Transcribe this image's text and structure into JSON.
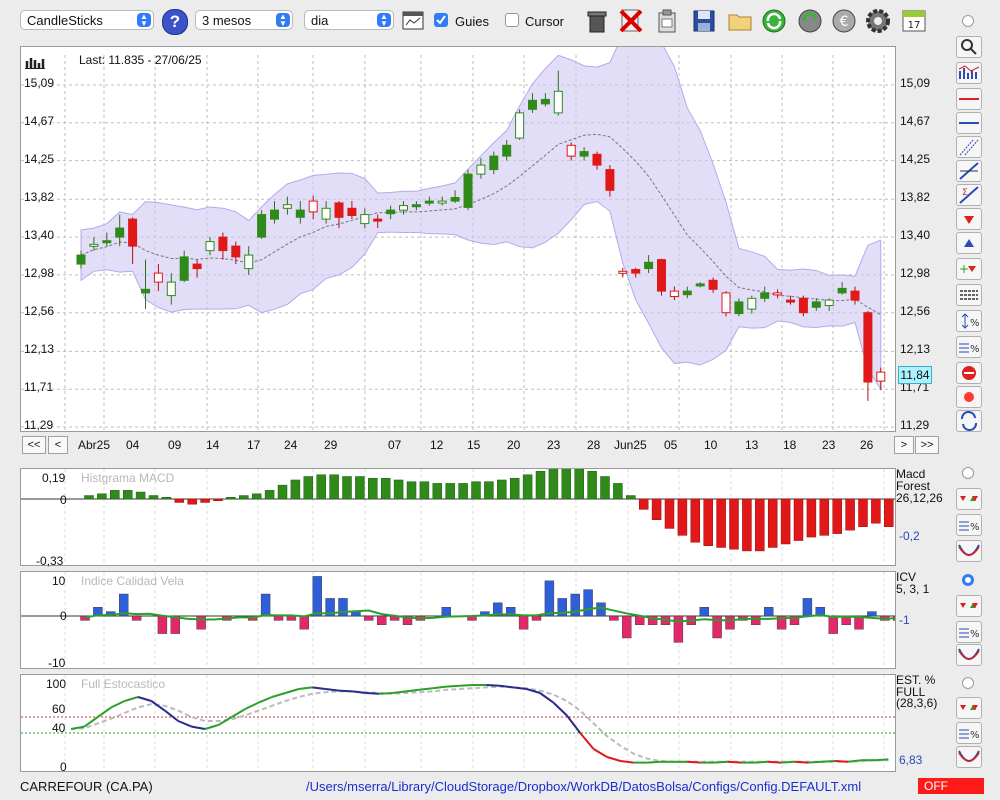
{
  "toolbar": {
    "chart_type": "CandleSticks",
    "period": "3 mesos",
    "interval": "dia",
    "guies_label": "Guies",
    "guies_checked": true,
    "cursor_label": "Cursor",
    "cursor_checked": false,
    "calendar_day": "17",
    "icons": [
      "help-icon",
      "trash-icon",
      "delete-icon",
      "clipboard-icon",
      "save-icon",
      "folder-icon",
      "refresh-icon",
      "refresh-alt-icon",
      "currency-icon",
      "gear-icon",
      "calendar-icon"
    ]
  },
  "price_chart": {
    "last_label": "Last: 11.835 - 27/06/25",
    "current_value": "11,84",
    "left_ticks": [
      "15,09",
      "14,67",
      "14,25",
      "13,82",
      "13,40",
      "12,98",
      "12,56",
      "12,13",
      "11,71",
      "11,29"
    ],
    "right_ticks": [
      "15,09",
      "14,67",
      "14,25",
      "13,82",
      "13,40",
      "12,98",
      "12,56",
      "12,13",
      "11,71",
      "11,29"
    ],
    "x_labels": [
      "Abr25",
      "04",
      "09",
      "14",
      "17",
      "24",
      "29",
      "07",
      "12",
      "15",
      "20",
      "23",
      "28",
      "Jun25",
      "05",
      "10",
      "13",
      "18",
      "23",
      "26"
    ],
    "nav": [
      "<<",
      "<",
      ">",
      ">>"
    ]
  },
  "macd": {
    "name": "Histgrama MACD",
    "ticks": [
      "0,19",
      "0",
      "-0,33"
    ],
    "legend1": "Macd",
    "legend2": "Forest",
    "params": "26,12,26",
    "value": "-0,2"
  },
  "icv": {
    "name": "Indice Calidad Vela",
    "ticks": [
      "10",
      "0",
      "-10"
    ],
    "legend1": "ICV",
    "params": "5, 3, 1",
    "value": "-1"
  },
  "stoch": {
    "name": "Full Estocastico",
    "ticks": [
      "100",
      "60",
      "40",
      "0"
    ],
    "legend1": "EST. %",
    "legend2": "FULL",
    "params": "(28,3,6)",
    "value": "6,83"
  },
  "status": {
    "ticker": "CARREFOUR (CA.PA)",
    "path": "/Users/mserra/Library/CloudStorage/Dropbox/WorkDB/DatosBolsa/Configs/Config.DEFAULT.xml",
    "toggle": "OFF"
  },
  "colors": {
    "up": "#2f8a1a",
    "down": "#e01818",
    "band": "#cfc8f3",
    "blue": "#2f5fd8",
    "pink": "#e0286a",
    "green_line": "#2aa02a"
  },
  "chart_data": [
    {
      "type": "candlestick",
      "title": "",
      "ylim": [
        11.29,
        15.09
      ],
      "candles": [
        [
          13.1,
          13.2,
          13.25,
          13.05,
          "up"
        ],
        [
          13.3,
          13.32,
          13.4,
          13.25,
          "up"
        ],
        [
          13.34,
          13.36,
          13.45,
          13.3,
          "up"
        ],
        [
          13.4,
          13.5,
          13.65,
          13.3,
          "up"
        ],
        [
          13.6,
          13.3,
          13.62,
          13.1,
          "down"
        ],
        [
          12.78,
          12.82,
          13.15,
          12.6,
          "up"
        ],
        [
          13.0,
          12.9,
          13.1,
          12.8,
          "down"
        ],
        [
          12.75,
          12.9,
          13.0,
          12.65,
          "up"
        ],
        [
          12.92,
          13.18,
          13.25,
          12.9,
          "up"
        ],
        [
          13.1,
          13.05,
          13.15,
          12.95,
          "down"
        ],
        [
          13.25,
          13.35,
          13.4,
          13.2,
          "up"
        ],
        [
          13.4,
          13.25,
          13.45,
          13.15,
          "down"
        ],
        [
          13.3,
          13.18,
          13.35,
          13.1,
          "down"
        ],
        [
          13.05,
          13.2,
          13.3,
          12.98,
          "up"
        ],
        [
          13.4,
          13.65,
          13.7,
          13.38,
          "up"
        ],
        [
          13.6,
          13.7,
          13.8,
          13.55,
          "up"
        ],
        [
          13.72,
          13.76,
          13.85,
          13.65,
          "up"
        ],
        [
          13.62,
          13.7,
          13.8,
          13.55,
          "up"
        ],
        [
          13.8,
          13.68,
          13.86,
          13.6,
          "down"
        ],
        [
          13.6,
          13.72,
          13.8,
          13.55,
          "up"
        ],
        [
          13.78,
          13.62,
          13.8,
          13.5,
          "down"
        ],
        [
          13.72,
          13.64,
          13.8,
          13.6,
          "down"
        ],
        [
          13.55,
          13.65,
          13.72,
          13.5,
          "up"
        ],
        [
          13.6,
          13.58,
          13.65,
          13.5,
          "down"
        ],
        [
          13.66,
          13.7,
          13.75,
          13.6,
          "up"
        ],
        [
          13.7,
          13.75,
          13.8,
          13.65,
          "up"
        ],
        [
          13.75,
          13.76,
          13.8,
          13.7,
          "up"
        ],
        [
          13.78,
          13.8,
          13.85,
          13.75,
          "up"
        ],
        [
          13.79,
          13.8,
          13.85,
          13.75,
          "up"
        ],
        [
          13.8,
          13.84,
          13.92,
          13.78,
          "up"
        ],
        [
          13.73,
          14.1,
          14.15,
          13.7,
          "up"
        ],
        [
          14.1,
          14.2,
          14.28,
          14.05,
          "up"
        ],
        [
          14.15,
          14.3,
          14.35,
          14.1,
          "up"
        ],
        [
          14.3,
          14.42,
          14.48,
          14.25,
          "up"
        ],
        [
          14.5,
          14.78,
          14.82,
          14.48,
          "up"
        ],
        [
          14.82,
          14.92,
          15.0,
          14.78,
          "up"
        ],
        [
          14.88,
          14.93,
          15.0,
          14.85,
          "up"
        ],
        [
          14.78,
          15.02,
          15.25,
          14.75,
          "up"
        ],
        [
          14.42,
          14.3,
          14.45,
          14.25,
          "down"
        ],
        [
          14.3,
          14.35,
          14.4,
          14.25,
          "up"
        ],
        [
          14.32,
          14.2,
          14.35,
          14.15,
          "down"
        ],
        [
          14.15,
          13.92,
          14.2,
          13.85,
          "down"
        ],
        [
          13.02,
          13.0,
          13.06,
          12.95,
          "down"
        ],
        [
          13.04,
          13.0,
          13.06,
          12.95,
          "down"
        ],
        [
          13.05,
          13.12,
          13.2,
          13.0,
          "up"
        ],
        [
          13.15,
          12.8,
          13.16,
          12.75,
          "down"
        ],
        [
          12.8,
          12.74,
          12.85,
          12.7,
          "down"
        ],
        [
          12.76,
          12.8,
          12.85,
          12.72,
          "up"
        ],
        [
          12.86,
          12.88,
          12.9,
          12.84,
          "up"
        ],
        [
          12.92,
          12.82,
          12.95,
          12.78,
          "down"
        ],
        [
          12.78,
          12.56,
          12.8,
          12.52,
          "down"
        ],
        [
          12.55,
          12.68,
          12.72,
          12.52,
          "up"
        ],
        [
          12.6,
          12.72,
          12.75,
          12.55,
          "up"
        ],
        [
          12.72,
          12.78,
          12.85,
          12.68,
          "up"
        ],
        [
          12.78,
          12.76,
          12.82,
          12.72,
          "down"
        ],
        [
          12.7,
          12.68,
          12.75,
          12.65,
          "down"
        ],
        [
          12.72,
          12.56,
          12.75,
          12.52,
          "down"
        ],
        [
          12.62,
          12.68,
          12.72,
          12.58,
          "up"
        ],
        [
          12.64,
          12.7,
          12.72,
          12.58,
          "up"
        ],
        [
          12.78,
          12.83,
          12.9,
          12.76,
          "up"
        ],
        [
          12.8,
          12.7,
          12.85,
          12.65,
          "down"
        ],
        [
          12.56,
          11.79,
          12.58,
          11.58,
          "down"
        ],
        [
          11.8,
          11.9,
          11.95,
          11.7,
          "down"
        ]
      ],
      "x_tick_labels": [
        "Abr25",
        "04",
        "09",
        "14",
        "17",
        "24",
        "29",
        "07",
        "12",
        "15",
        "20",
        "23",
        "28",
        "Jun25",
        "05",
        "10",
        "13",
        "18",
        "23",
        "26"
      ]
    },
    {
      "type": "bar",
      "title": "Histgrama MACD",
      "ylim": [
        -0.33,
        0.19
      ],
      "values": [
        0.02,
        0.03,
        0.05,
        0.05,
        0.04,
        0.02,
        0.01,
        -0.02,
        -0.03,
        -0.02,
        -0.01,
        0.01,
        0.02,
        0.03,
        0.05,
        0.08,
        0.11,
        0.13,
        0.14,
        0.14,
        0.13,
        0.13,
        0.12,
        0.12,
        0.11,
        0.1,
        0.1,
        0.09,
        0.09,
        0.09,
        0.1,
        0.1,
        0.11,
        0.12,
        0.14,
        0.16,
        0.19,
        0.2,
        0.19,
        0.16,
        0.13,
        0.09,
        0.02,
        -0.06,
        -0.12,
        -0.17,
        -0.21,
        -0.25,
        -0.27,
        -0.28,
        -0.29,
        -0.3,
        -0.3,
        -0.28,
        -0.26,
        -0.24,
        -0.22,
        -0.21,
        -0.2,
        -0.18,
        -0.16,
        -0.14,
        -0.16,
        -0.2
      ]
    },
    {
      "type": "bar",
      "title": "Indice Calidad Vela",
      "ylim": [
        -10,
        10
      ],
      "values": [
        -1,
        2,
        1,
        5,
        -1,
        0,
        -4,
        -4,
        0,
        -3,
        0,
        -1,
        0,
        -1,
        5,
        -1,
        -1,
        -3,
        9,
        4,
        4,
        1,
        -1,
        -2,
        -1,
        -2,
        -1,
        0,
        2,
        0,
        -1,
        1,
        3,
        2,
        -3,
        -1,
        8,
        4,
        5,
        6,
        3,
        -1,
        -5,
        -2,
        -2,
        -2,
        -6,
        -2,
        2,
        -5,
        -3,
        -1,
        -2,
        2,
        -3,
        -2,
        4,
        2,
        -4,
        -2,
        -3,
        1,
        -1,
        -1,
        4,
        -12,
        -1
      ]
    },
    {
      "type": "line",
      "title": "Full Estocastico",
      "ylim": [
        0,
        100
      ],
      "series": [
        {
          "name": "%K",
          "values": [
            45,
            48,
            60,
            72,
            80,
            85,
            80,
            68,
            55,
            48,
            45,
            50,
            60,
            70,
            78,
            85,
            90,
            95,
            97,
            95,
            93,
            92,
            90,
            89,
            90,
            92,
            94,
            96,
            98,
            99,
            100,
            100,
            99,
            97,
            95,
            90,
            78,
            62,
            40,
            20,
            10,
            5,
            3,
            3,
            4,
            4,
            4,
            3,
            3,
            4,
            3,
            3,
            4,
            3,
            4,
            3,
            4,
            5,
            4,
            6,
            6,
            7
          ]
        },
        {
          "name": "%D",
          "values": [
            45,
            46,
            52,
            58,
            65,
            72,
            76,
            74,
            68,
            60,
            55,
            55,
            57,
            62,
            68,
            74,
            80,
            85,
            89,
            91,
            92,
            92,
            91,
            90,
            89,
            90,
            91,
            92,
            94,
            95,
            96,
            97,
            98,
            97,
            96,
            93,
            88,
            80,
            68,
            52,
            36,
            24,
            14,
            8,
            5,
            4,
            4,
            4,
            4,
            4,
            4,
            4,
            4,
            4,
            4,
            4,
            4,
            4,
            4,
            5,
            6,
            6
          ]
        }
      ]
    }
  ]
}
